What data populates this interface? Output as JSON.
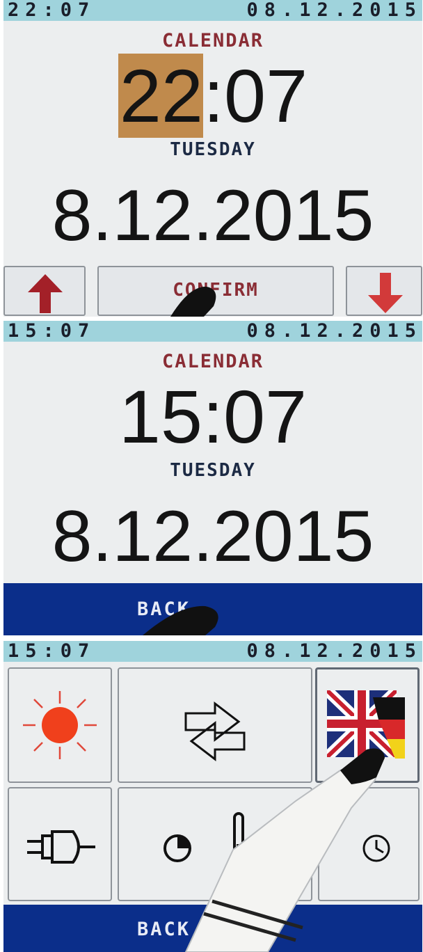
{
  "screens": [
    {
      "status": {
        "time": "22:07",
        "date": "08.12.2015"
      },
      "title": "CALENDAR",
      "time_hours": "22",
      "time_sep_minutes": ":07",
      "weekday": "TUESDAY",
      "date": "8.12.2015",
      "buttons": {
        "up_icon": "arrow-up-icon",
        "confirm_label": "CONFIRM",
        "down_icon": "arrow-down-icon"
      }
    },
    {
      "status": {
        "time": "15:07",
        "date": "08.12.2015"
      },
      "title": "CALENDAR",
      "time": "15:07",
      "weekday": "TUESDAY",
      "date": "8.12.2015",
      "back_label": "BACK"
    },
    {
      "status": {
        "time": "15:07",
        "date": "08.12.2015"
      },
      "tiles": [
        {
          "icon": "sun-icon",
          "selected": false
        },
        {
          "icon": "swap-arrows-icon",
          "selected": false
        },
        {
          "icon": "language-flags-icon",
          "selected": true
        },
        {
          "icon": "plug-icon",
          "selected": false
        },
        {
          "icon": "timer-thermometer-icon",
          "selected": false
        },
        {
          "icon": "clock-icon",
          "selected": false
        }
      ],
      "back_label": "BACK"
    }
  ],
  "colors": {
    "status_bar": "#9fd3dc",
    "title_red": "#8a2d35",
    "highlight": "#c08a4c",
    "back_bar": "#0b2e8a",
    "sun": "#f0401c"
  }
}
